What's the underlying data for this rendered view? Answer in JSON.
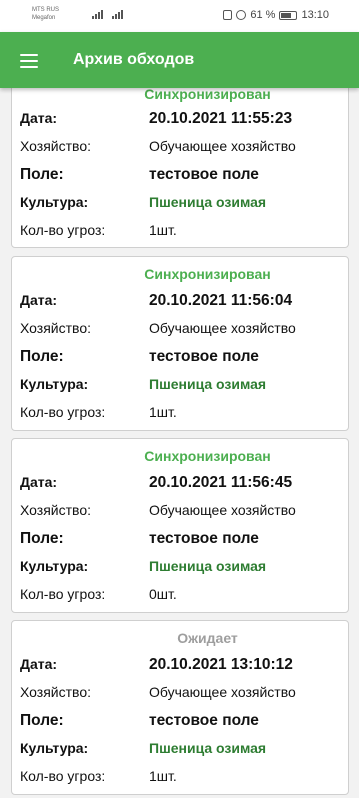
{
  "status_bar": {
    "carrier_line1": "MTS RUS",
    "carrier_line2": "Megafon",
    "battery_text": "61 %",
    "time": "13:10"
  },
  "app_bar": {
    "title": "Архив обходов",
    "menu_icon": "hamburger-menu-icon",
    "color": "#4caf50"
  },
  "labels": {
    "date": "Дата:",
    "farm": "Хозяйство:",
    "field": "Поле:",
    "crop": "Культура:",
    "threats": "Кол-во угроз:"
  },
  "records": [
    {
      "status": "Синхронизирован",
      "date": "20.10.2021 11:55:23",
      "farm": "Обучающее хозяйство",
      "field": "тестовое поле",
      "crop": "Пшеница озимая",
      "threats": "1шт."
    },
    {
      "status": "Синхронизирован",
      "date": "20.10.2021 11:56:04",
      "farm": "Обучающее хозяйство",
      "field": "тестовое поле",
      "crop": "Пшеница озимая",
      "threats": "1шт."
    },
    {
      "status": "Синхронизирован",
      "date": "20.10.2021 11:56:45",
      "farm": "Обучающее хозяйство",
      "field": "тестовое поле",
      "crop": "Пшеница озимая",
      "threats": "0шт."
    },
    {
      "status": "Ожидает",
      "date": "20.10.2021 13:10:12",
      "farm": "Обучающее хозяйство",
      "field": "тестовое поле",
      "crop": "Пшеница озимая",
      "threats": "1шт."
    }
  ],
  "colors": {
    "synced": "#4caf50",
    "pending": "#9e9e9e",
    "crop": "#2e7d32"
  }
}
